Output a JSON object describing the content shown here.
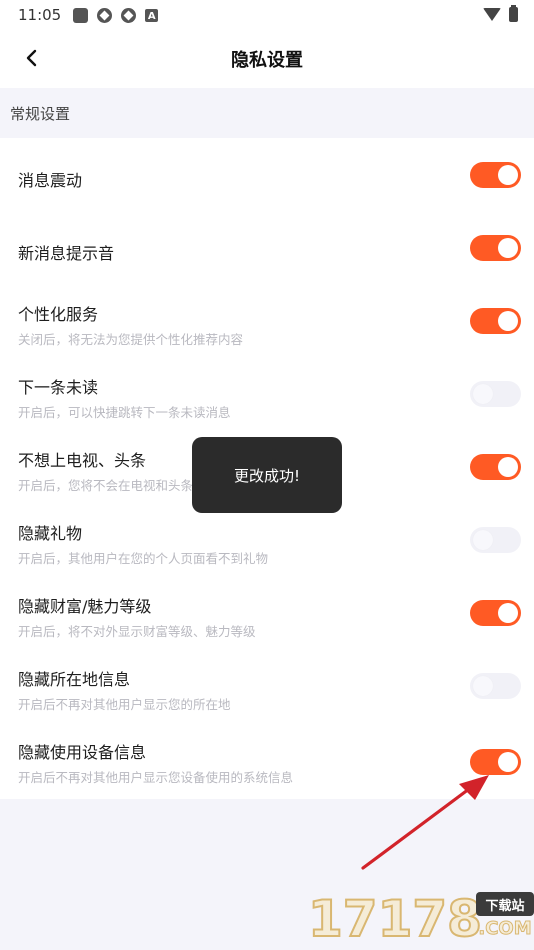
{
  "status_bar": {
    "time": "11:05",
    "a_label": "A"
  },
  "nav": {
    "title": "隐私设置"
  },
  "section": {
    "label": "常规设置"
  },
  "settings": [
    {
      "title": "消息震动",
      "subtitle": "",
      "enabled": true
    },
    {
      "title": "新消息提示音",
      "subtitle": "",
      "enabled": true
    },
    {
      "title": "个性化服务",
      "subtitle": "关闭后，将无法为您提供个性化推荐内容",
      "enabled": true
    },
    {
      "title": "下一条未读",
      "subtitle": "开启后，可以快捷跳转下一条未读消息",
      "enabled": false
    },
    {
      "title": "不想上电视、头条",
      "subtitle": "开启后，您将不会在电视和头条上",
      "enabled": true
    },
    {
      "title": "隐藏礼物",
      "subtitle": "开启后，其他用户在您的个人页面看不到礼物",
      "enabled": false
    },
    {
      "title": "隐藏财富/魅力等级",
      "subtitle": "开启后，将不对外显示财富等级、魅力等级",
      "enabled": true
    },
    {
      "title": "隐藏所在地信息",
      "subtitle": "开启后不再对其他用户显示您的所在地",
      "enabled": false
    },
    {
      "title": "隐藏使用设备信息",
      "subtitle": "开启后不再对其他用户显示您设备使用的系统信息",
      "enabled": true
    }
  ],
  "toast": {
    "message": "更改成功!"
  },
  "watermark": {
    "number": "17178",
    "badge": "下载站",
    "suffix": ".COM"
  },
  "colors": {
    "toggle_on": "#ff5a24",
    "toggle_off": "#f1f1f7",
    "arrow": "#d2232a"
  }
}
